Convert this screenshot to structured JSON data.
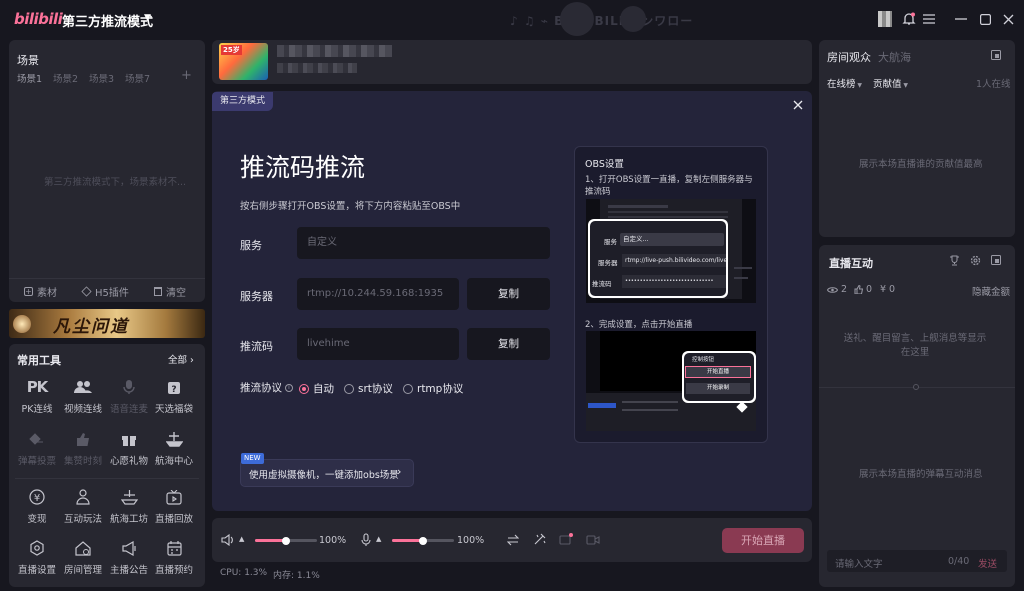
{
  "titlebar": {
    "logo": "bilibili",
    "mode": "第三方推流模式",
    "deco_text": "♪ ♫ ⌁  BIlILIBILI  ꤰ  ンワロー"
  },
  "scene": {
    "title": "场景",
    "tabs": [
      "场景1",
      "场景2",
      "场景3",
      "场景7"
    ],
    "add": "+",
    "empty": "第三方推流模式下，场景素材不...",
    "actions": [
      "素材",
      "H5插件",
      "清空"
    ]
  },
  "banner": {
    "text": "凡尘问道"
  },
  "tools": {
    "title": "常用工具",
    "all": "全部",
    "row1": [
      {
        "label": "PK连线",
        "icon": "pk-icon",
        "enabled": true
      },
      {
        "label": "视频连线",
        "icon": "users-icon",
        "enabled": true
      },
      {
        "label": "语音连麦",
        "icon": "mic-icon",
        "enabled": false
      },
      {
        "label": "天选福袋",
        "icon": "lucky-bag-icon",
        "enabled": true
      }
    ],
    "row2": [
      {
        "label": "弹幕投票",
        "icon": "vote-icon",
        "enabled": false
      },
      {
        "label": "集赞时刻",
        "icon": "thumb-icon",
        "enabled": false
      },
      {
        "label": "心愿礼物",
        "icon": "gift-icon",
        "enabled": true
      },
      {
        "label": "航海中心",
        "icon": "ship-icon",
        "enabled": true
      }
    ],
    "row3": [
      {
        "label": "变现",
        "icon": "yen-icon",
        "enabled": true
      },
      {
        "label": "互动玩法",
        "icon": "play-icon",
        "enabled": true
      },
      {
        "label": "航海工坊",
        "icon": "workshop-icon",
        "enabled": true
      },
      {
        "label": "直播回放",
        "icon": "tv-icon",
        "enabled": true
      }
    ],
    "row4": [
      {
        "label": "直播设置",
        "icon": "settings-icon",
        "enabled": true
      },
      {
        "label": "房间管理",
        "icon": "home-icon",
        "enabled": true
      },
      {
        "label": "主播公告",
        "icon": "megaphone-icon",
        "enabled": true
      },
      {
        "label": "直播预约",
        "icon": "calendar-icon",
        "enabled": true
      }
    ]
  },
  "modal": {
    "badge": "第三方模式",
    "title": "推流码推流",
    "desc": "按右侧步骤打开OBS设置，将下方内容粘贴至OBS中",
    "service_label": "服务",
    "service_value": "自定义",
    "server_label": "服务器",
    "server_value": "rtmp://10.244.59.168:1935",
    "code_label": "推流码",
    "code_value": "livehime",
    "copy": "复制",
    "protocol_label": "推流协议",
    "protocols": [
      "自动",
      "srt协议",
      "rtmp协议"
    ],
    "new_tag": "NEW",
    "vcam": "使用虚拟摄像机，一键添加obs场景",
    "obs_title": "OBS设置",
    "step1": "1、打开OBS设置一直播，复制左侧服务器与推流码",
    "step2": "2、完成设置，点击开始直播",
    "shot1": {
      "service": "服务",
      "service_val": "自定义...",
      "server": "服务器",
      "server_val": "rtmp://live-push.bilivideo.com/live",
      "code": "推流码",
      "code_val": "••••••••••••••••••••••••••••••"
    },
    "shot2": {
      "header": "控制按钮",
      "start": "开始直播",
      "record": "开始录制"
    }
  },
  "bottom": {
    "vol1": "100%",
    "vol2": "100%",
    "vol1_level": 0.5,
    "vol2_level": 0.5,
    "start": "开始直播",
    "cpu": "CPU: 1.3%",
    "mem": "内存: 1.1%"
  },
  "audience": {
    "tab_active": "房间观众",
    "tab_other": "大航海",
    "sub1": "在线榜",
    "sub2": "贡献值",
    "online": "1人在线",
    "empty": "展示本场直播谁的贡献值最高"
  },
  "interact": {
    "title": "直播互动",
    "views": "2",
    "likes": "0",
    "coins": "0",
    "hide": "隐藏金额",
    "empty1": "送礼、醒目留言、上舰消息等显示在这里",
    "empty2": "展示本场直播的弹幕互动消息",
    "input_ph": "请输入文字",
    "count": "0/40",
    "send": "发送"
  },
  "colors": {
    "accent": "#fb7299",
    "bg": "#17171f",
    "panel": "#272730"
  }
}
